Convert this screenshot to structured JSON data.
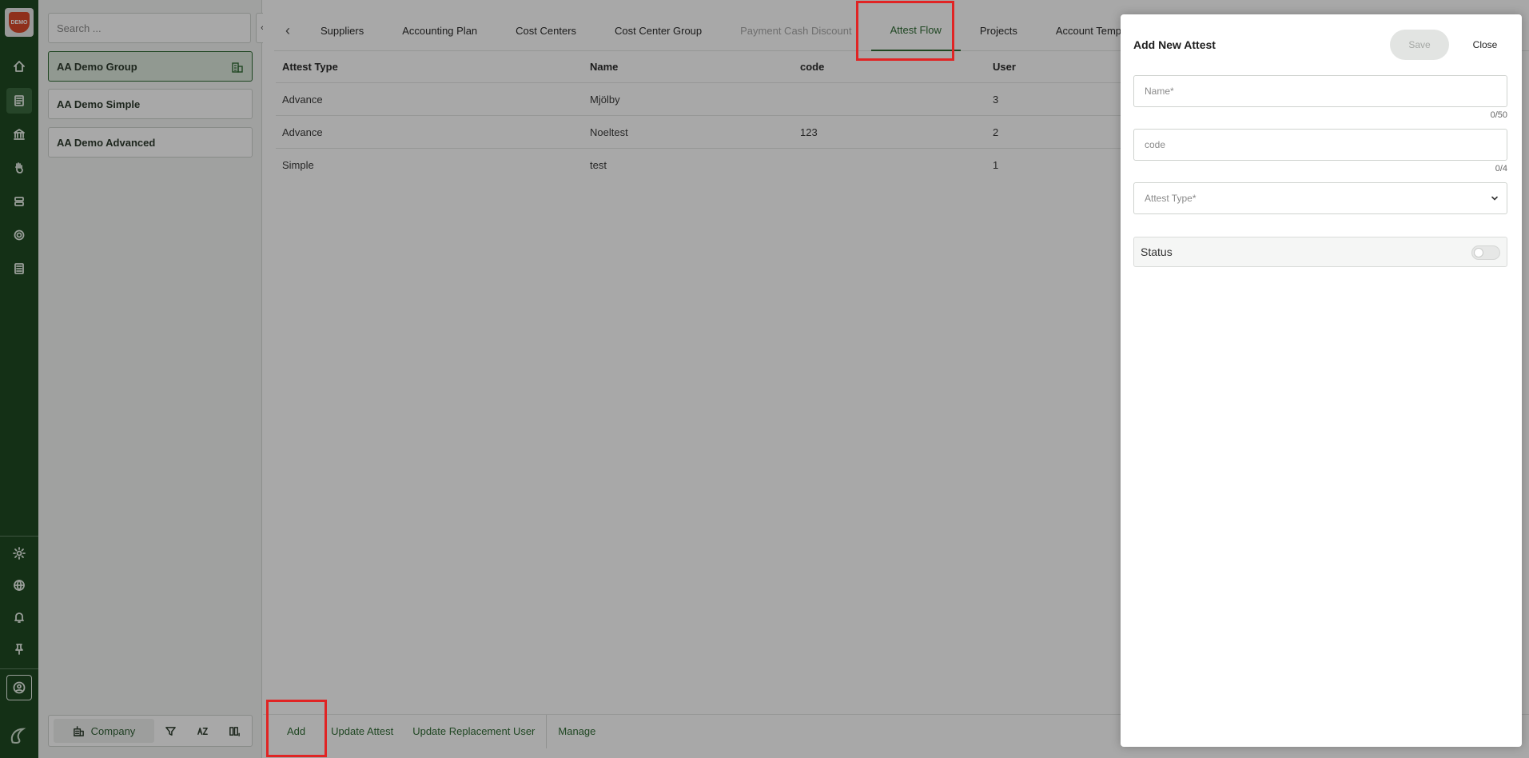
{
  "rail": {
    "logo_text": "DEMO",
    "icons": [
      "home-icon",
      "document-icon",
      "bank-icon",
      "hand-icon",
      "database-icon",
      "gear-icon",
      "list-icon"
    ],
    "bottom_icons": [
      "sun-icon",
      "globe-icon",
      "bell-icon",
      "pin-icon",
      "user-circle-icon"
    ]
  },
  "company_panel": {
    "search_placeholder": "Search ...",
    "companies": [
      {
        "name": "AA Demo Group",
        "selected": true
      },
      {
        "name": "AA Demo Simple",
        "selected": false
      },
      {
        "name": "AA Demo Advanced",
        "selected": false
      }
    ],
    "toolbar": {
      "company_label": "Company"
    }
  },
  "tabs": [
    {
      "label": "Suppliers",
      "state": "normal"
    },
    {
      "label": "Accounting Plan",
      "state": "normal"
    },
    {
      "label": "Cost Centers",
      "state": "normal"
    },
    {
      "label": "Cost Center Group",
      "state": "normal"
    },
    {
      "label": "Payment Cash Discount",
      "state": "disabled"
    },
    {
      "label": "Attest Flow",
      "state": "active"
    },
    {
      "label": "Projects",
      "state": "normal"
    },
    {
      "label": "Account Templates",
      "state": "normal"
    }
  ],
  "table": {
    "headers": {
      "type": "Attest Type",
      "name": "Name",
      "code": "code",
      "user": "User"
    },
    "rows": [
      {
        "type": "Advance",
        "name": "Mjölby",
        "code": "",
        "user": "3"
      },
      {
        "type": "Advance",
        "name": "Noeltest",
        "code": "123",
        "user": "2"
      },
      {
        "type": "Simple",
        "name": "test",
        "code": "",
        "user": "1"
      }
    ]
  },
  "bottom_bar": {
    "add": "Add",
    "update_attest": "Update Attest",
    "update_replacement_user": "Update Replacement User",
    "manage": "Manage"
  },
  "drawer": {
    "title": "Add New Attest",
    "save": "Save",
    "close": "Close",
    "name_placeholder": "Name*",
    "name_counter": "0/50",
    "code_placeholder": "code",
    "code_counter": "0/4",
    "attest_type_placeholder": "Attest Type*",
    "status_label": "Status"
  },
  "colors": {
    "accent": "#2f6b34",
    "rail": "#1f4a22",
    "highlight": "#e02424"
  }
}
